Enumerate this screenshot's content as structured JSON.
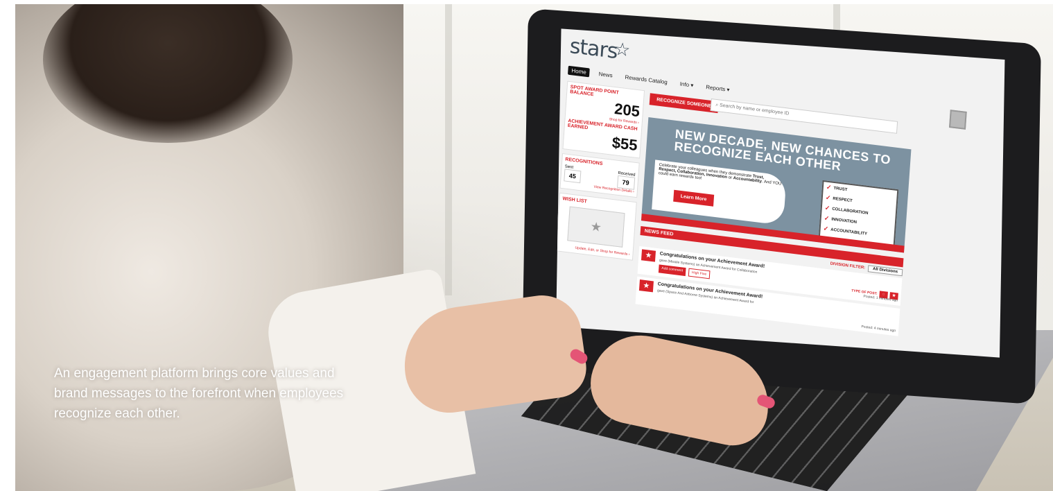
{
  "caption": "An engagement platform brings core values and brand messages to the forefront when employees recognize each other.",
  "app": {
    "logo": "stars",
    "nav": [
      "Home",
      "News",
      "Rewards Catalog",
      "Info ▾",
      "Reports ▾"
    ],
    "spot": {
      "title": "SPOT AWARD POINT BALANCE",
      "value": "205",
      "link": "Shop for Rewards ›"
    },
    "achievement": {
      "title": "ACHIEVEMENT AWARD CASH EARNED",
      "value": "$55"
    },
    "recognitions": {
      "title": "RECOGNITIONS",
      "sent_label": "Sent",
      "sent": "45",
      "received_label": "Received",
      "received": "79",
      "link": "View Recognition Details ›"
    },
    "wishlist": {
      "title": "WISH LIST",
      "link": "Update, Edit, or Shop for Rewards ›"
    },
    "recognize_btn": "RECOGNIZE SOMEONE",
    "search_placeholder": "Search by name or employee ID",
    "banner": {
      "headline": "NEW DECADE, NEW CHANCES TO RECOGNIZE EACH OTHER",
      "body_lead": "Celebrate your colleagues when they demonstrate",
      "body_values": "Trust, Respect, Collaboration, Innovation",
      "body_or": "or",
      "body_acc": "Accountability",
      "body_tail": ". And YOU could earn rewards too!",
      "learn_more": "Learn More",
      "checklist": [
        "TRUST",
        "RESPECT",
        "COLLABORATION",
        "INNOVATION",
        "ACCOUNTABILITY"
      ]
    },
    "feed": {
      "title": "NEWS FEED",
      "filter_label": "DIVISION FILTER:",
      "filter_value": "All Divisions",
      "type_label": "TYPE OF POST:",
      "posts": [
        {
          "title": "Congratulations on your Achievement Award!",
          "gave": "gave",
          "detail": "(Missile Systems) an Achievement Award for Collaboration",
          "add_comment": "Add comment",
          "high_five": "High Five",
          "posted": "Posted: 1 minutes ago"
        },
        {
          "title": "Congratulations on your Achievement Award!",
          "gave": "gave",
          "detail": "(Space And Airborne Systems) an Achievement Award for",
          "posted": "Posted: 4 minutes ago"
        }
      ]
    }
  }
}
